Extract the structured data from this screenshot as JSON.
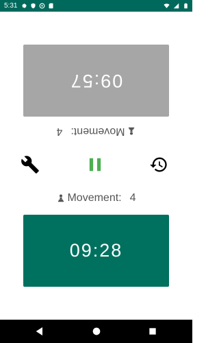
{
  "status_bar": {
    "time": "5:31",
    "icons_left": [
      "gear-icon",
      "shield-icon",
      "sync-icon",
      "sd-card-icon"
    ],
    "icons_right": [
      "wifi-icon",
      "signal-icon",
      "battery-icon"
    ]
  },
  "player_top": {
    "clock": "09:57",
    "movement_label": "Movement:",
    "movement_value": "4",
    "piece_icon": "pawn-icon",
    "color": "#a6a6a6"
  },
  "player_bottom": {
    "clock": "09:28",
    "movement_label": "Movement:",
    "movement_value": "4",
    "piece_icon": "pawn-icon",
    "color": "#00715f"
  },
  "controls": {
    "settings_icon": "wrench-icon",
    "pause_icon": "pause-icon",
    "history_icon": "history-icon",
    "pause_color": "#4caf50"
  },
  "nav_bar": [
    "back-icon",
    "home-icon",
    "recents-icon"
  ]
}
